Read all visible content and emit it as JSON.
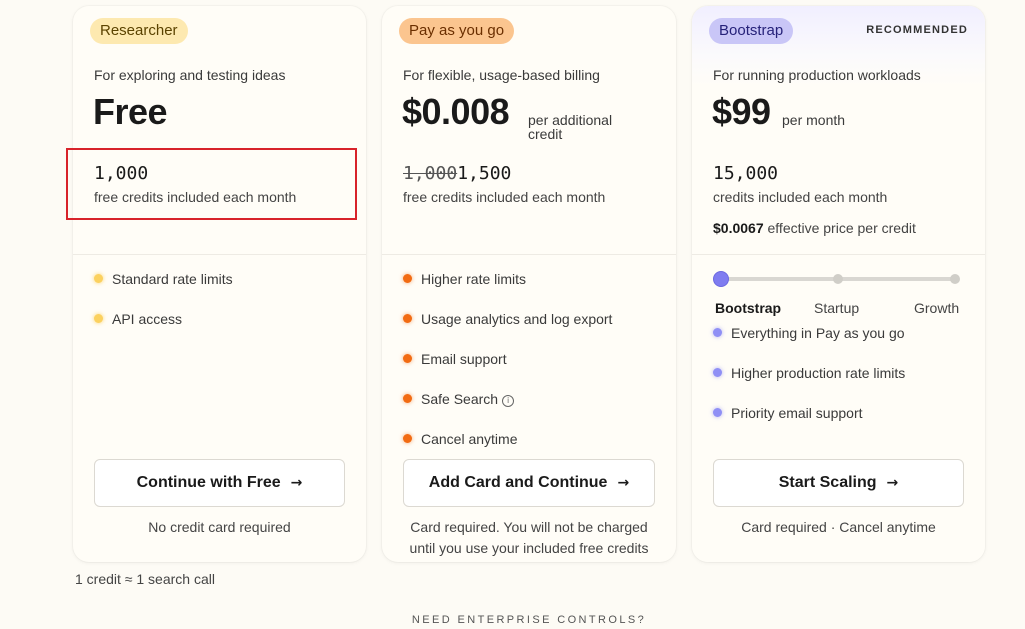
{
  "plans": {
    "researcher": {
      "badge": "Researcher",
      "subtitle": "For exploring and testing ideas",
      "price": "Free",
      "credits": "1,000",
      "credits_desc": "free credits included each month",
      "features": [
        "Standard rate limits",
        "API access"
      ],
      "cta_label": "Continue with Free",
      "cta_note": "No credit card required"
    },
    "payg": {
      "badge": "Pay as you go",
      "subtitle": "For flexible, usage-based billing",
      "price": "$0.008",
      "price_note_line1": "per additional",
      "price_note_line2": "credit",
      "credits_old": "1,000",
      "credits": "1,500",
      "credits_desc": "free credits included each month",
      "features": [
        "Higher rate limits",
        "Usage analytics and log export",
        "Email support",
        "Safe Search",
        "Cancel anytime"
      ],
      "info_icon": "i",
      "cta_label": "Add Card and Continue",
      "cta_note_line1": "Card required. You will not be charged",
      "cta_note_line2": "until you use your included free credits"
    },
    "bootstrap": {
      "badge": "Bootstrap",
      "recommended": "RECOMMENDED",
      "subtitle": "For running production workloads",
      "price": "$99",
      "price_note": "per month",
      "credits": "15,000",
      "credits_desc": "credits included each month",
      "effective_price": "$0.0067",
      "effective_label": "effective price per credit",
      "tiers": [
        "Bootstrap",
        "Startup",
        "Growth"
      ],
      "selected_tier": "Bootstrap",
      "features": [
        "Everything in Pay as you go",
        "Higher production rate limits",
        "Priority email support"
      ],
      "cta_label": "Start Scaling",
      "cta_note": "Card required · Cancel anytime"
    }
  },
  "arrow_glyph": "→",
  "footnote": "1 credit ≈ 1 search call",
  "enterprise_heading": "NEED ENTERPRISE CONTROLS?",
  "colors": {
    "background": "#fdfbf5",
    "researcher_badge": "#fde9b0",
    "payg_badge": "#fbc58f",
    "bootstrap_badge": "#c9c6f7",
    "yellow_dot": "#fbd15f",
    "orange_dot": "#f26b12",
    "purple_dot": "#8f8ff5",
    "highlight_border": "#d8232a"
  }
}
